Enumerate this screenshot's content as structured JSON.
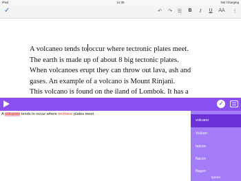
{
  "status_bar": {
    "device": "iPad",
    "wifi_icon": "wifi-icon",
    "time": "11:35",
    "battery": "Not Charging"
  },
  "toolbar": {
    "done_icon": "checkmark-icon",
    "undo_icon": "undo-icon",
    "redo_icon": "redo-icon",
    "list_icon": "list-icon",
    "bold": "B",
    "italic": "I",
    "underline": "U",
    "font_size": "AA",
    "more_icon": "more-vertical-icon"
  },
  "document": {
    "lines": [
      {
        "before_cursor": "A volcaneo tends to",
        "after_cursor": "occur where tectronic plates meet."
      },
      {
        "text": "The earth is made up of about 8 big tectonic plates."
      },
      {
        "text": "When volcanoes erupt they can throw out lava, ash and"
      },
      {
        "text": "gases. An example of a volcano is Mount Rinjani."
      },
      {
        "text": "This volcano is found on the iland of Lombok.  It has a"
      }
    ]
  },
  "reader_bar": {
    "play_icon": "play-icon",
    "done_icon": "check-circle-icon",
    "keyboard_icon": "keyboard-icon",
    "color": "#8a4ff0"
  },
  "sentence": {
    "prefix": "A ",
    "error_word": "volcaneo",
    "middle": " tends to occur where ",
    "flagged_word": "tectronic",
    "suffix": " plates meet."
  },
  "suggestions": {
    "items": [
      "volcano",
      "Vulcan",
      "falcon",
      "flacon",
      "flagon"
    ],
    "selected_index": 0,
    "ignore_label": "Ignore"
  }
}
